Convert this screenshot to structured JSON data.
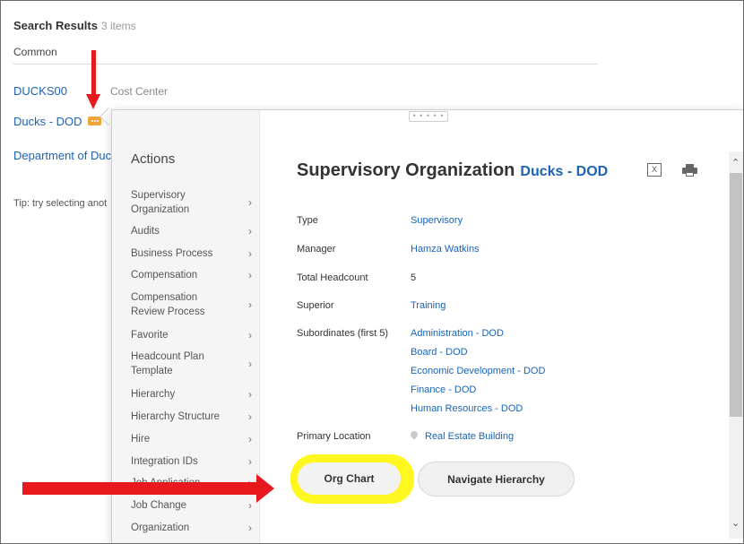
{
  "search": {
    "title": "Search Results",
    "count": "3 items",
    "category": "Common",
    "results": [
      {
        "label": "DUCKS00",
        "sub": "Cost Center"
      },
      {
        "label": "Ducks - DOD"
      },
      {
        "label": "Department of Duc"
      }
    ],
    "tip": "Tip: try selecting anot"
  },
  "popup": {
    "drag_handle": "• • • • •",
    "actions": {
      "title": "Actions",
      "items": [
        "Supervisory Organization",
        "Audits",
        "Business Process",
        "Compensation",
        "Compensation Review Process",
        "Favorite",
        "Headcount Plan Template",
        "Hierarchy",
        "Hierarchy Structure",
        "Hire",
        "Integration IDs",
        "Job Application",
        "Job Change",
        "Organization"
      ]
    },
    "header": {
      "title": "Supervisory Organization",
      "org_name": "Ducks - DOD"
    },
    "fields": {
      "type_label": "Type",
      "type_value": "Supervisory",
      "manager_label": "Manager",
      "manager_value": "Hamza Watkins",
      "headcount_label": "Total Headcount",
      "headcount_value": "5",
      "superior_label": "Superior",
      "superior_value": "Training",
      "subordinates_label": "Subordinates (first 5)",
      "subordinates": [
        "Administration - DOD",
        "Board - DOD",
        "Economic Development - DOD",
        "Finance - DOD",
        "Human Resources - DOD"
      ],
      "location_label": "Primary Location",
      "location_value": "Real Estate Building"
    },
    "buttons": {
      "org_chart": "Org Chart",
      "navigate_hierarchy": "Navigate Hierarchy"
    }
  },
  "colors": {
    "link": "#1a63b8",
    "annotation_arrow": "#e8191d",
    "highlight": "#fff600",
    "related_button": "#f0a43a"
  },
  "icons": [
    "related-actions-icon",
    "export-excel-icon",
    "print-icon",
    "location-pin-icon",
    "chevron-right-icon",
    "scroll-up-icon",
    "scroll-down-icon"
  ]
}
